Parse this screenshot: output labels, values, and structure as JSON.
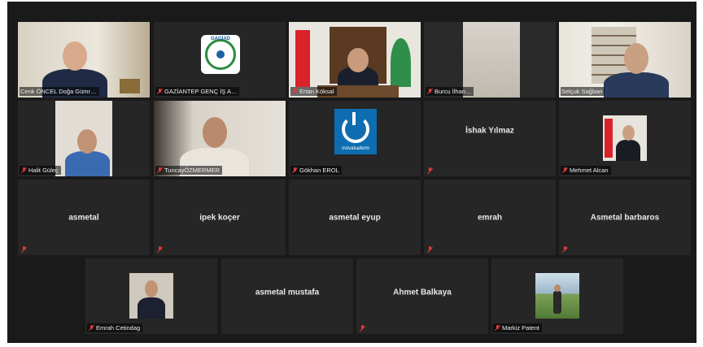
{
  "meeting": {
    "participants": [
      {
        "name": "Cenk ÖNCEL Doğa Gümr…",
        "muted": false
      },
      {
        "name": "GAZİANTEP GENÇ İŞ A…",
        "muted": true,
        "logo": "GAGİAD"
      },
      {
        "name": "Ertan Köksal",
        "muted": true,
        "active": true
      },
      {
        "name": "Burcu İlhan…",
        "muted": true
      },
      {
        "name": "Selçuk Sağban",
        "muted": false
      },
      {
        "name": "Halit Güleç",
        "muted": true
      },
      {
        "name": "TuncayÖZMERMER",
        "muted": true
      },
      {
        "name": "Gökhan EROL",
        "muted": true,
        "logo": "inovakademi"
      },
      {
        "name": "İshak Yılmaz",
        "muted": true,
        "display_name": "İshak Yılmaz"
      },
      {
        "name": "Mehmet Alcan",
        "muted": true
      },
      {
        "name": "asmetal",
        "muted": true,
        "display_name": "asmetal"
      },
      {
        "name": "ipek koçer",
        "muted": true,
        "display_name": "ipek koçer"
      },
      {
        "name": "asmetal eyup",
        "muted": false,
        "display_name": "asmetal eyup"
      },
      {
        "name": "emrah",
        "muted": true,
        "display_name": "emrah"
      },
      {
        "name": "Asmetal barbaros",
        "muted": true,
        "display_name": "Asmetal barbaros"
      },
      {
        "name": "Emrah Cetindag",
        "muted": true
      },
      {
        "name": "asmetal mustafa",
        "muted": false,
        "display_name": "asmetal mustafa"
      },
      {
        "name": "Ahmet Balkaya",
        "muted": true,
        "display_name": "Ahmet Balkaya"
      },
      {
        "name": "Markiz Patent",
        "muted": true
      }
    ]
  },
  "colors": {
    "stage": "#1a1a1a",
    "tile": "#262626",
    "active_border": "#c9d94a",
    "muted_icon": "#e23b3b"
  },
  "icons": {
    "muted": "mic-muted-icon"
  }
}
